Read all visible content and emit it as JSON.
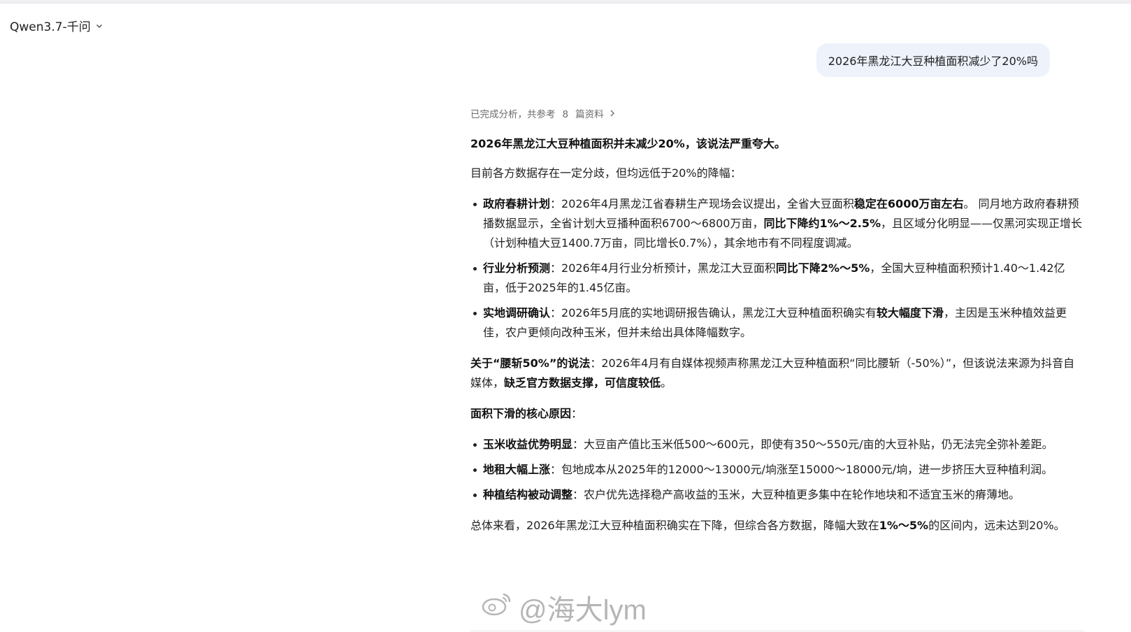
{
  "header": {
    "model_name": "Qwen3.7-千问"
  },
  "user_message": {
    "text": "2026年黑龙江大豆种植面积减少了20%吗"
  },
  "analysis": {
    "prefix": "已完成分析，共参考",
    "count": "8",
    "suffix": "篇资料"
  },
  "answer": {
    "headline": "2026年黑龙江大豆种植面积并未减少20%，该说法严重夸大。",
    "intro": "目前各方数据存在一定分歧，但均远低于20%的降幅：",
    "data_points": [
      {
        "title": "政府春耕计划",
        "t1": "：2026年4月黑龙江省春耕生产现场会议提出，全省大豆面积",
        "b1": "稳定在6000万亩左右",
        "t2": "。 同月地方政府春耕预播数据显示，全省计划大豆播种面积6700～6800万亩，",
        "b2": "同比下降约1%～2.5%",
        "t3": "，且区域分化明显——仅黑河实现正增长（计划种植大豆1400.7万亩，同比增长0.7%），其余地市有不同程度调减。"
      },
      {
        "title": "行业分析预测",
        "t1": "：2026年4月行业分析预计，黑龙江大豆面积",
        "b1": "同比下降2%～5%",
        "t2": "，全国大豆种植面积预计1.40～1.42亿亩，低于2025年的1.45亿亩。",
        "b2": "",
        "t3": ""
      },
      {
        "title": "实地调研确认",
        "t1": "：2026年5月底的实地调研报告确认，黑龙江大豆种植面积确实有",
        "b1": "较大幅度下滑",
        "t2": "，主因是玉米种植效益更佳，农户更倾向改种玉米，但并未给出具体降幅数字。",
        "b2": "",
        "t3": ""
      }
    ],
    "claim": {
      "title": "关于“腰斩50%”的说法",
      "t1": "：2026年4月有自媒体视频声称黑龙江大豆种植面积“同比腰斩（-50%）”，但该说法来源为抖音自媒体，",
      "b1": "缺乏官方数据支撑，可信度较低",
      "t2": "。"
    },
    "reasons_title": "面积下滑的核心原因",
    "reasons_colon": "：",
    "reasons": [
      {
        "title": "玉米收益优势明显",
        "text": "：大豆亩产值比玉米低500～600元，即使有350～550元/亩的大豆补贴，仍无法完全弥补差距。"
      },
      {
        "title": "地租大幅上涨",
        "text": "：包地成本从2025年的12000～13000元/垧涨至15000～18000元/垧，进一步挤压大豆种植利润。"
      },
      {
        "title": "种植结构被动调整",
        "text": "：农户优先选择稳产高收益的玉米，大豆种植更多集中在轮作地块和不适宜玉米的瘠薄地。"
      }
    ],
    "conclusion": {
      "t1": "总体来看，2026年黑龙江大豆种植面积确实在下降，但综合各方数据，降幅大致在",
      "b1": "1%～5%",
      "t2": "的区间内，远未达到20%。"
    }
  },
  "watermark": {
    "text": "@海大lym"
  }
}
